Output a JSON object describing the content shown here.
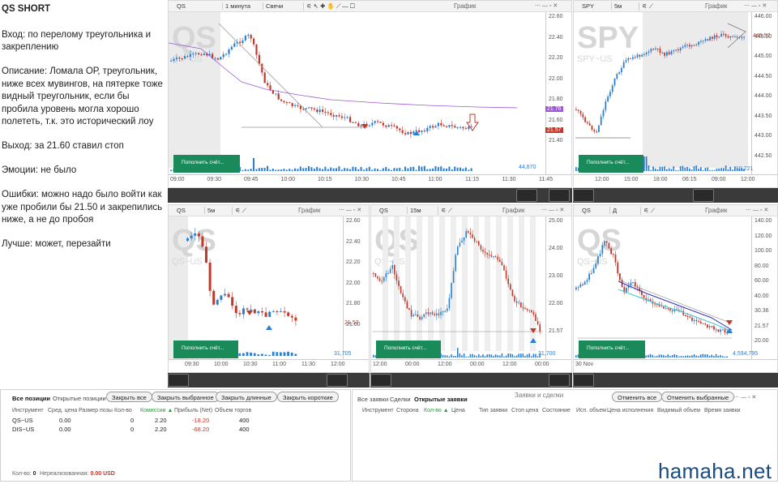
{
  "notes": {
    "title": "QS SHORT",
    "entry": "Вход: по перелому треугольника и закреплению",
    "description": "Описание: Ломала ОР, треугольник, ниже всех мувингов, на пятерке тоже видный треугольник, если бы пробила уровень могла хорошо полететь, т.к. это исторический лоу",
    "exit": "Выход: за 21.60 ставил стоп",
    "emotions": "Эмоции: не было",
    "mistakes": "Ошибки: можно надо было войти как уже пробили бы 21.50 и закрепились ниже, а не до пробоя",
    "better": "Лучше: может, перезайти"
  },
  "common": {
    "chart_title": "График",
    "replenish_button": "Пополнить счёт...",
    "ctl_icons": "⋯ — ▫ ✕"
  },
  "charts": {
    "main": {
      "symbol": "QS",
      "interval": "1 минута",
      "chart_type": "Свечи",
      "watermark": "QS",
      "watermark_sub": "QS~US",
      "y_ticks": [
        "22.60",
        "22.40",
        "22.20",
        "22.00",
        "21.80",
        "21.60",
        "21.40"
      ],
      "price_badge": "21.57",
      "price_badge2": "21.76",
      "x_ticks": [
        "09:00",
        "09:30",
        "09:45",
        "10:00",
        "10:15",
        "10:30",
        "10:45",
        "11:00",
        "11:15",
        "11:30",
        "11:45"
      ],
      "volume_label": "44,870"
    },
    "spy": {
      "symbol": "SPY",
      "interval": "5м",
      "watermark": "SPY",
      "watermark_sub": "SPY~US",
      "y_ticks": [
        "446.00",
        "445.50",
        "445.00",
        "444.50",
        "444.00",
        "443.50",
        "443.00",
        "442.50"
      ],
      "price_badge": "445.57",
      "x_ticks": [
        "12:00",
        "15:00",
        "18:00",
        "06:15",
        "09:00",
        "12:00"
      ],
      "volume_label": "10,221"
    },
    "qs5": {
      "symbol": "QS",
      "interval": "5м",
      "watermark": "QS",
      "watermark_sub": "QS~US",
      "y_ticks": [
        "22.60",
        "22.40",
        "22.20",
        "22.00",
        "21.80",
        "21.60"
      ],
      "price_badge": "21.57",
      "x_ticks": [
        "09:30",
        "10:00",
        "10:30",
        "11:00",
        "11:30",
        "12:00"
      ],
      "volume_label": "31,705"
    },
    "qs15": {
      "symbol": "QS",
      "interval": "15м",
      "watermark": "QS",
      "watermark_sub": "QS~US",
      "y_ticks": [
        "25.00",
        "24.00",
        "23.00",
        "22.00",
        "21.57"
      ],
      "price_badge": "21.57",
      "x_ticks": [
        "12:00",
        "00:00",
        "12:00",
        "00:00",
        "12:00",
        "00:00"
      ],
      "volume_label": "31,700"
    },
    "qsd": {
      "symbol": "QS",
      "interval": "Д",
      "watermark": "QS",
      "watermark_sub": "QS~US",
      "y_ticks": [
        "140.00",
        "120.00",
        "100.00",
        "80.00",
        "60.00",
        "40.00",
        "30.36",
        "21.57",
        "20.00"
      ],
      "price_badge": "30.36",
      "x_ticks": [
        "30 Nov"
      ],
      "volume_label": "4,594,795"
    }
  },
  "positions": {
    "tabs": [
      "Все позиции",
      "Открытые позиции"
    ],
    "buttons": [
      "Закрыть все",
      "Закрыть выбранное",
      "Закрыть длинные",
      "Закрыть короткие"
    ],
    "headers": [
      "Инструмент",
      "Сред. цена",
      "Размер позы",
      "Кол-во",
      "Комиссии ▲",
      "Прибыль (Net)",
      "Объем торгов"
    ],
    "rows": [
      {
        "instrument": "QS~US",
        "avg": "0.00",
        "size": "",
        "qty": "0",
        "commission": "2.20",
        "profit": "-18.20",
        "volume": "400"
      },
      {
        "instrument": "DIS~US",
        "avg": "0.00",
        "size": "",
        "qty": "0",
        "commission": "2.20",
        "profit": "-68.20",
        "volume": "400"
      }
    ],
    "footer_qty_label": "Кол-во:",
    "footer_qty": "0",
    "footer_unreal_label": "Нереализованная:",
    "footer_unreal": "0.00 USD"
  },
  "orders": {
    "title": "Заявки и сделки",
    "tabs": [
      "Все заявки",
      "Сделки",
      "Открытые заявки"
    ],
    "buttons": [
      "Отменить все",
      "Отменить выбранные"
    ],
    "headers": [
      "Инструмент",
      "Сторона",
      "Кол-во ▲",
      "Цена",
      "Тип заявки",
      "Стоп цена",
      "Состояние",
      "Исп. объем",
      "Цена исполнения",
      "Видимый объем",
      "Время заявки"
    ]
  },
  "brand": "hamaha.net",
  "colors": {
    "up": "#2a7fd4",
    "down": "#c0392b",
    "accent": "#1b8a5a",
    "ma": "#9b59d0"
  }
}
